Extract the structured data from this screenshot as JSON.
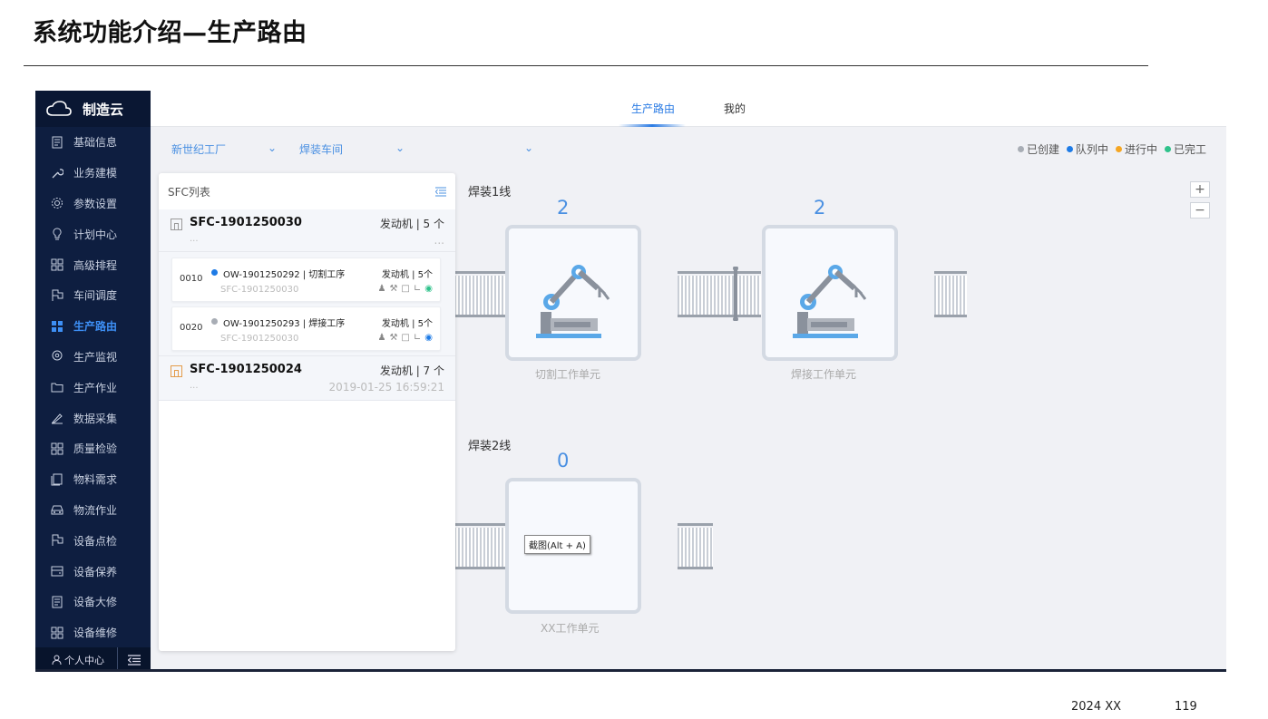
{
  "slide": {
    "title": "系统功能介绍—生产路由",
    "footer_year": "2024 XX",
    "page_number": "119"
  },
  "app": {
    "brand": "制造云",
    "sidebar": {
      "items": [
        {
          "label": "基础信息",
          "icon": "document-icon"
        },
        {
          "label": "业务建模",
          "icon": "wrench-icon"
        },
        {
          "label": "参数设置",
          "icon": "gear-icon"
        },
        {
          "label": "计划中心",
          "icon": "bulb-icon"
        },
        {
          "label": "高级排程",
          "icon": "grid-icon"
        },
        {
          "label": "车间调度",
          "icon": "flag-icon"
        },
        {
          "label": "生产路由",
          "icon": "grid-filled-icon",
          "active": true
        },
        {
          "label": "生产监视",
          "icon": "location-icon"
        },
        {
          "label": "生产作业",
          "icon": "folder-icon"
        },
        {
          "label": "数据采集",
          "icon": "pen-icon"
        },
        {
          "label": "质量检验",
          "icon": "grid-icon"
        },
        {
          "label": "物料需求",
          "icon": "copy-icon"
        },
        {
          "label": "物流作业",
          "icon": "car-icon"
        },
        {
          "label": "设备点检",
          "icon": "flag-icon"
        },
        {
          "label": "设备保养",
          "icon": "card-icon"
        },
        {
          "label": "设备大修",
          "icon": "document-icon"
        },
        {
          "label": "设备维修",
          "icon": "grid-icon"
        }
      ],
      "footer_user": "个人中心"
    },
    "tabs": [
      {
        "label": "生产路由",
        "active": true
      },
      {
        "label": "我的"
      }
    ],
    "filters": {
      "factory": "新世纪工厂",
      "workshop": "焊装车间",
      "line": ""
    },
    "legend": [
      {
        "label": "已创建",
        "color": "#a8adb5"
      },
      {
        "label": "队列中",
        "color": "#1e7be6"
      },
      {
        "label": "进行中",
        "color": "#f5a623"
      },
      {
        "label": "已完工",
        "color": "#2fc28b"
      }
    ],
    "zoom": {
      "in": "+",
      "out": "−"
    },
    "sfc_panel": {
      "title": "SFC列表",
      "orders": [
        {
          "code": "SFC-1901250030",
          "meta": "发动机 | 5 个",
          "sub": "...",
          "date": "...",
          "operations": [
            {
              "seq": "0010",
              "title": "OW-1901250292 | 切割工序",
              "right": "发动机 | 5个",
              "sfc": "SFC-1901250030",
              "status_color": "#1e7be6",
              "pin_color": "#2fc28b"
            },
            {
              "seq": "0020",
              "title": "OW-1901250293 | 焊接工序",
              "right": "发动机 | 5个",
              "sfc": "SFC-1901250030",
              "status_color": "#a8adb5",
              "pin_color": "#1e7be6"
            }
          ]
        },
        {
          "code": "SFC-1901250024",
          "meta": "发动机 | 7 个",
          "sub": "...",
          "date": "2019-01-25 16:59:21"
        }
      ]
    },
    "lines": [
      {
        "label": "焊装1线",
        "units": [
          {
            "count": "2",
            "name": "切割工作单元"
          },
          {
            "count": "2",
            "name": "焊接工作单元"
          }
        ]
      },
      {
        "label": "焊装2线",
        "units": [
          {
            "count": "0",
            "name": "XX工作单元"
          }
        ]
      }
    ],
    "tooltip": "截图(Alt + A)"
  }
}
